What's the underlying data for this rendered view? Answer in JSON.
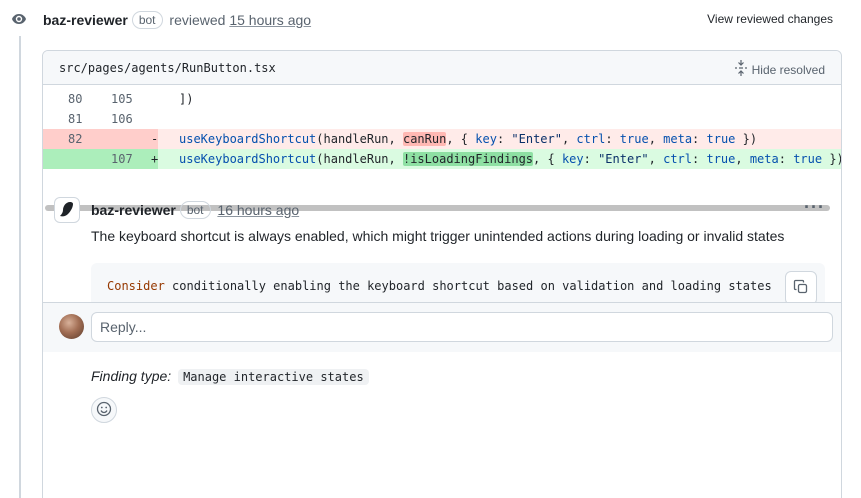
{
  "review": {
    "author": "baz-reviewer",
    "bot_label": "bot",
    "action": "reviewed",
    "time": "15 hours ago",
    "view_changes_label": "View reviewed changes"
  },
  "file": {
    "path": "src/pages/agents/RunButton.tsx",
    "hide_resolved_label": "Hide resolved"
  },
  "diff": {
    "rows": [
      {
        "old": "80",
        "new": "105",
        "sign": "",
        "text": "])"
      },
      {
        "old": "81",
        "new": "106",
        "sign": "",
        "text": ""
      },
      {
        "old": "82",
        "new": "",
        "sign": "-",
        "parts": [
          "useKeyboardShortcut",
          "(handleRun, ",
          "canRun",
          ", { ",
          "key",
          ": ",
          "\"Enter\"",
          ", ",
          "ctrl",
          ": ",
          "true",
          ", ",
          "meta",
          ": ",
          "true",
          " })"
        ]
      },
      {
        "old": "",
        "new": "107",
        "sign": "+",
        "parts": [
          "useKeyboardShortcut",
          "(handleRun, ",
          "!isLoadingFindings",
          ", { ",
          "key",
          ": ",
          "\"Enter\"",
          ", ",
          "ctrl",
          ": ",
          "true",
          ", ",
          "meta",
          ": ",
          "true",
          " })"
        ]
      }
    ]
  },
  "comment": {
    "author": "baz-reviewer",
    "bot_label": "bot",
    "time": "16 hours ago",
    "menu_label": "···",
    "body": "The keyboard shortcut is always enabled, which might trigger unintended actions during loading or invalid states",
    "suggestion_first_word": "Consider",
    "suggestion_rest": " conditionally enabling the keyboard shortcut based on validation and loading states",
    "finding_label": "Finding type:",
    "finding_tag": "Manage interactive states"
  },
  "reply": {
    "placeholder": "Reply..."
  }
}
